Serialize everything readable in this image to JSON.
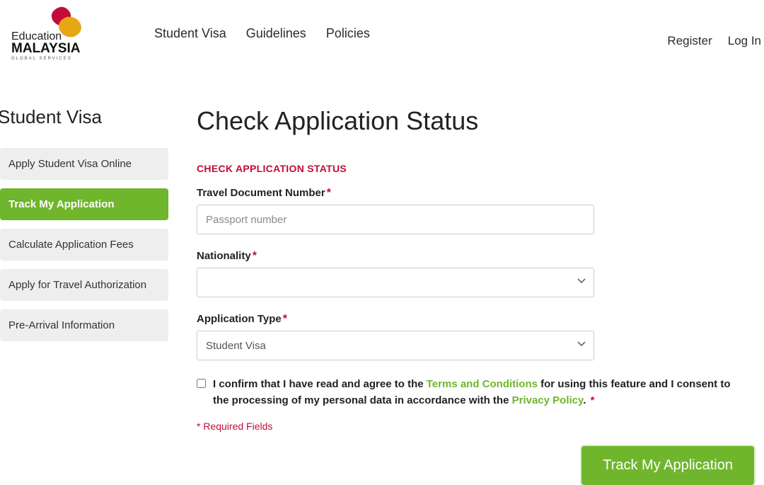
{
  "header": {
    "logo_top": "Education",
    "logo_main": "MALAYSIA",
    "logo_sub": "GLOBAL SERVICES",
    "nav": [
      "Student Visa",
      "Guidelines",
      "Policies"
    ],
    "right": [
      "Register",
      "Log In"
    ]
  },
  "sidebar": {
    "title": "Student Visa",
    "items": [
      {
        "label": "Apply Student Visa Online",
        "active": false
      },
      {
        "label": "Track My Application",
        "active": true
      },
      {
        "label": "Calculate Application Fees",
        "active": false
      },
      {
        "label": "Apply for Travel Authorization",
        "active": false
      },
      {
        "label": "Pre-Arrival Information",
        "active": false
      }
    ]
  },
  "main": {
    "title": "Check Application Status",
    "form_heading": "CHECK APPLICATION STATUS",
    "fields": {
      "travel_doc": {
        "label": "Travel Document Number",
        "placeholder": "Passport number",
        "value": ""
      },
      "nationality": {
        "label": "Nationality",
        "value": ""
      },
      "app_type": {
        "label": "Application Type",
        "value": "Student Visa"
      }
    },
    "consent_parts": {
      "p1": "I confirm that I have read and agree to the ",
      "link1": "Terms and Conditions",
      "p2": " for using this feature and I consent to the processing of my personal data in accordance with the ",
      "link2": "Privacy Policy",
      "p3": ". "
    },
    "required_note": "* Required Fields",
    "submit_label": "Track My Application",
    "asterisk": "*"
  }
}
